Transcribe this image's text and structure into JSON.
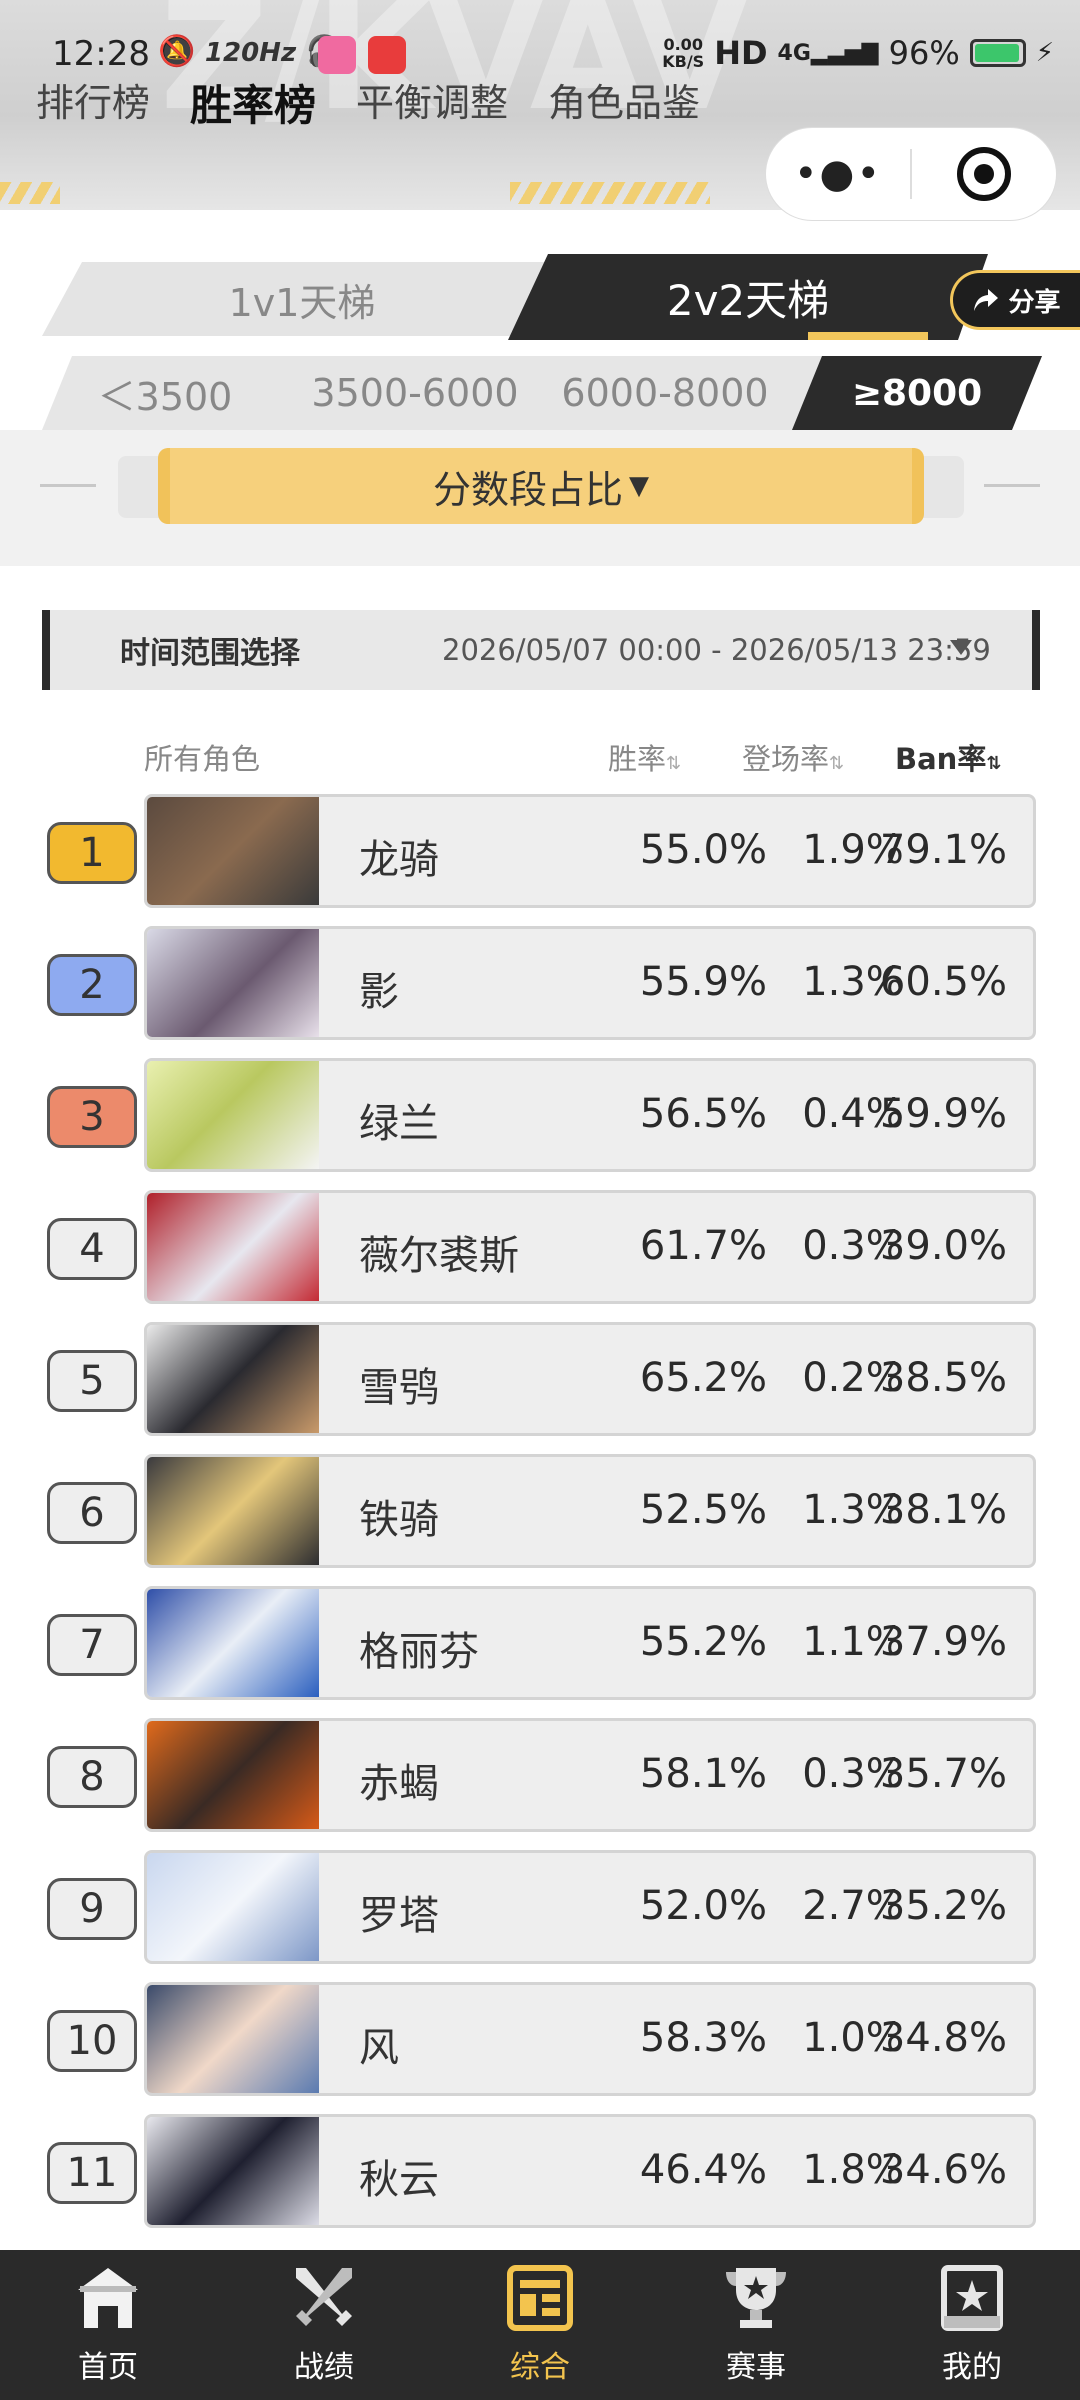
{
  "status_bar": {
    "time": "12:28",
    "refresh": "120Hz",
    "net_speed_top": "0.00",
    "net_speed_bottom": "KB/S",
    "hd": "HD",
    "signal": "4G",
    "battery": "96%"
  },
  "top_nav": {
    "tabs": [
      "排行榜",
      "胜率榜",
      "平衡调整",
      "角色品鉴"
    ],
    "active_index": 1
  },
  "mode_tabs": [
    "1v1天梯",
    "2v2天梯"
  ],
  "share_button": "分享",
  "score_ranges": [
    "＜3500",
    "3500-6000",
    "6000-8000",
    "≥8000"
  ],
  "score_share_button": "分数段占比",
  "time_range": {
    "label": "时间范围选择",
    "value": "2026/05/07 00:00 - 2026/05/13 23:59"
  },
  "table": {
    "headers": {
      "character": "所有角色",
      "win_rate": "胜率",
      "appearance_rate": "登场率",
      "ban_rate": "Ban率"
    },
    "rows": [
      {
        "rank": "1",
        "name": "龙骑",
        "win": "55.0%",
        "appear": "1.9%",
        "ban": "79.1%"
      },
      {
        "rank": "2",
        "name": "影",
        "win": "55.9%",
        "appear": "1.3%",
        "ban": "60.5%"
      },
      {
        "rank": "3",
        "name": "绿兰",
        "win": "56.5%",
        "appear": "0.4%",
        "ban": "59.9%"
      },
      {
        "rank": "4",
        "name": "薇尔裘斯",
        "win": "61.7%",
        "appear": "0.3%",
        "ban": "39.0%"
      },
      {
        "rank": "5",
        "name": "雪鸮",
        "win": "65.2%",
        "appear": "0.2%",
        "ban": "38.5%"
      },
      {
        "rank": "6",
        "name": "铁骑",
        "win": "52.5%",
        "appear": "1.3%",
        "ban": "38.1%"
      },
      {
        "rank": "7",
        "name": "格丽芬",
        "win": "55.2%",
        "appear": "1.1%",
        "ban": "37.9%"
      },
      {
        "rank": "8",
        "name": "赤蝎",
        "win": "58.1%",
        "appear": "0.3%",
        "ban": "35.7%"
      },
      {
        "rank": "9",
        "name": "罗塔",
        "win": "52.0%",
        "appear": "2.7%",
        "ban": "35.2%"
      },
      {
        "rank": "10",
        "name": "风",
        "win": "58.3%",
        "appear": "1.0%",
        "ban": "34.8%"
      },
      {
        "rank": "11",
        "name": "秋云",
        "win": "46.4%",
        "appear": "1.8%",
        "ban": "34.6%"
      }
    ]
  },
  "bottom_nav": {
    "items": [
      "首页",
      "战绩",
      "综合",
      "赛事",
      "我的"
    ],
    "active_index": 2
  },
  "colors": {
    "accent_gold": "#f3c44e",
    "rank1": "#f2b92f",
    "rank2": "#8eaaf0",
    "rank3": "#ec8a6b",
    "dark": "#2b2b2b"
  }
}
